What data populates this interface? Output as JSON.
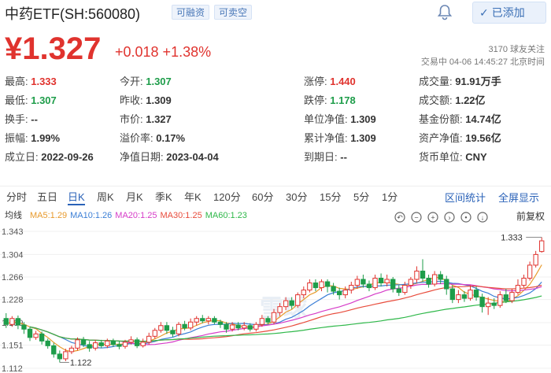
{
  "header": {
    "title": "中药ETF(SH:560080)",
    "tags": [
      "可融资",
      "可卖空"
    ],
    "add_label": "已添加"
  },
  "quote": {
    "price": "¥1.327",
    "change": "+0.018  +1.38%",
    "followers": "3170 球友关注",
    "trade_time": "交易中 04-06 14:45:27 北京时间"
  },
  "stats": [
    {
      "label": "最高:",
      "value": "1.333",
      "cls": "up"
    },
    {
      "label": "今开:",
      "value": "1.307",
      "cls": "down"
    },
    {
      "label": "涨停:",
      "value": "1.440",
      "cls": "up"
    },
    {
      "label": "成交量:",
      "value": "91.91万手",
      "cls": ""
    },
    {
      "label": "最低:",
      "value": "1.307",
      "cls": "down"
    },
    {
      "label": "昨收:",
      "value": "1.309",
      "cls": ""
    },
    {
      "label": "跌停:",
      "value": "1.178",
      "cls": "down"
    },
    {
      "label": "成交额:",
      "value": "1.22亿",
      "cls": ""
    },
    {
      "label": "换手:",
      "value": "--",
      "cls": ""
    },
    {
      "label": "市价:",
      "value": "1.327",
      "cls": ""
    },
    {
      "label": "单位净值:",
      "value": "1.309",
      "cls": ""
    },
    {
      "label": "基金份额:",
      "value": "14.74亿",
      "cls": ""
    },
    {
      "label": "振幅:",
      "value": "1.99%",
      "cls": ""
    },
    {
      "label": "溢价率:",
      "value": "0.17%",
      "cls": ""
    },
    {
      "label": "累计净值:",
      "value": "1.309",
      "cls": ""
    },
    {
      "label": "资产净值:",
      "value": "19.56亿",
      "cls": ""
    },
    {
      "label": "成立日:",
      "value": "2022-09-26",
      "cls": ""
    },
    {
      "label": "净值日期:",
      "value": "2023-04-04",
      "cls": ""
    },
    {
      "label": "到期日:",
      "value": "--",
      "cls": ""
    },
    {
      "label": "货币单位:",
      "value": "CNY",
      "cls": ""
    }
  ],
  "tabs": [
    "分时",
    "五日",
    "日K",
    "周K",
    "月K",
    "季K",
    "年K",
    "120分",
    "60分",
    "30分",
    "15分",
    "5分",
    "1分"
  ],
  "active_tab": "日K",
  "right_links": [
    "区间统计",
    "全屏显示"
  ],
  "chart": {
    "ma_label": "均线",
    "ma": [
      {
        "name": "MA5:1.29",
        "color": "#e89a2c"
      },
      {
        "name": "MA10:1.26",
        "color": "#3c7fd6"
      },
      {
        "name": "MA20:1.25",
        "color": "#d63cc8"
      },
      {
        "name": "MA30:1.25",
        "color": "#e84c3c"
      },
      {
        "name": "MA60:1.23",
        "color": "#2fb84a"
      }
    ],
    "adjust": "前复权",
    "y_ticks": [
      "1.343",
      "1.304",
      "1.266",
      "1.228",
      "1.189",
      "1.151",
      "1.112"
    ],
    "hi_label": "1.333",
    "lo_label": "1.122",
    "watermark": "雪球"
  },
  "chart_data": {
    "type": "candlestick",
    "ylim": [
      1.112,
      1.343
    ],
    "candles": [
      [
        1.196,
        1.186,
        1.205,
        1.18
      ],
      [
        1.186,
        1.196,
        1.2,
        1.182
      ],
      [
        1.196,
        1.185,
        1.201,
        1.178
      ],
      [
        1.185,
        1.178,
        1.19,
        1.17
      ],
      [
        1.178,
        1.164,
        1.182,
        1.158
      ],
      [
        1.164,
        1.17,
        1.175,
        1.16
      ],
      [
        1.17,
        1.158,
        1.174,
        1.152
      ],
      [
        1.158,
        1.15,
        1.162,
        1.145
      ],
      [
        1.15,
        1.136,
        1.155,
        1.13
      ],
      [
        1.136,
        1.128,
        1.142,
        1.122
      ],
      [
        1.128,
        1.14,
        1.145,
        1.124
      ],
      [
        1.14,
        1.146,
        1.15,
        1.136
      ],
      [
        1.146,
        1.16,
        1.164,
        1.142
      ],
      [
        1.16,
        1.152,
        1.165,
        1.148
      ],
      [
        1.152,
        1.146,
        1.158,
        1.14
      ],
      [
        1.146,
        1.155,
        1.16,
        1.142
      ],
      [
        1.155,
        1.15,
        1.16,
        1.146
      ],
      [
        1.15,
        1.158,
        1.162,
        1.146
      ],
      [
        1.158,
        1.152,
        1.162,
        1.148
      ],
      [
        1.152,
        1.149,
        1.158,
        1.144
      ],
      [
        1.149,
        1.156,
        1.16,
        1.145
      ],
      [
        1.156,
        1.16,
        1.166,
        1.152
      ],
      [
        1.16,
        1.15,
        1.164,
        1.146
      ],
      [
        1.15,
        1.156,
        1.162,
        1.147
      ],
      [
        1.156,
        1.166,
        1.172,
        1.152
      ],
      [
        1.166,
        1.176,
        1.18,
        1.162
      ],
      [
        1.176,
        1.184,
        1.19,
        1.172
      ],
      [
        1.184,
        1.176,
        1.19,
        1.17
      ],
      [
        1.176,
        1.17,
        1.182,
        1.165
      ],
      [
        1.17,
        1.186,
        1.19,
        1.166
      ],
      [
        1.186,
        1.18,
        1.192,
        1.176
      ],
      [
        1.18,
        1.19,
        1.196,
        1.176
      ],
      [
        1.19,
        1.196,
        1.2,
        1.184
      ],
      [
        1.196,
        1.192,
        1.202,
        1.188
      ],
      [
        1.192,
        1.196,
        1.2,
        1.186
      ],
      [
        1.196,
        1.19,
        1.2,
        1.186
      ],
      [
        1.19,
        1.186,
        1.194,
        1.18
      ],
      [
        1.186,
        1.178,
        1.19,
        1.172
      ],
      [
        1.178,
        1.185,
        1.19,
        1.174
      ],
      [
        1.185,
        1.18,
        1.19,
        1.176
      ],
      [
        1.18,
        1.184,
        1.19,
        1.176
      ],
      [
        1.184,
        1.178,
        1.188,
        1.174
      ],
      [
        1.178,
        1.186,
        1.19,
        1.174
      ],
      [
        1.186,
        1.196,
        1.202,
        1.182
      ],
      [
        1.196,
        1.19,
        1.2,
        1.186
      ],
      [
        1.19,
        1.206,
        1.212,
        1.186
      ],
      [
        1.206,
        1.216,
        1.222,
        1.2
      ],
      [
        1.216,
        1.226,
        1.232,
        1.21
      ],
      [
        1.226,
        1.218,
        1.232,
        1.212
      ],
      [
        1.218,
        1.236,
        1.24,
        1.214
      ],
      [
        1.236,
        1.244,
        1.25,
        1.23
      ],
      [
        1.244,
        1.256,
        1.262,
        1.24
      ],
      [
        1.256,
        1.248,
        1.262,
        1.242
      ],
      [
        1.248,
        1.258,
        1.262,
        1.242
      ],
      [
        1.258,
        1.25,
        1.262,
        1.24
      ],
      [
        1.25,
        1.242,
        1.256,
        1.236
      ],
      [
        1.242,
        1.236,
        1.248,
        1.228
      ],
      [
        1.236,
        1.244,
        1.25,
        1.23
      ],
      [
        1.244,
        1.252,
        1.258,
        1.238
      ],
      [
        1.252,
        1.262,
        1.268,
        1.246
      ],
      [
        1.262,
        1.254,
        1.27,
        1.248
      ],
      [
        1.254,
        1.248,
        1.26,
        1.242
      ],
      [
        1.248,
        1.264,
        1.27,
        1.244
      ],
      [
        1.264,
        1.256,
        1.272,
        1.25
      ],
      [
        1.256,
        1.262,
        1.27,
        1.25
      ],
      [
        1.262,
        1.246,
        1.266,
        1.24
      ],
      [
        1.246,
        1.24,
        1.252,
        1.234
      ],
      [
        1.24,
        1.252,
        1.258,
        1.236
      ],
      [
        1.252,
        1.262,
        1.266,
        1.246
      ],
      [
        1.262,
        1.276,
        1.284,
        1.256
      ],
      [
        1.276,
        1.264,
        1.296,
        1.258
      ],
      [
        1.264,
        1.254,
        1.27,
        1.248
      ],
      [
        1.254,
        1.27,
        1.276,
        1.25
      ],
      [
        1.27,
        1.262,
        1.276,
        1.254
      ],
      [
        1.262,
        1.246,
        1.268,
        1.236
      ],
      [
        1.246,
        1.228,
        1.252,
        1.222
      ],
      [
        1.228,
        1.236,
        1.244,
        1.222
      ],
      [
        1.236,
        1.23,
        1.242,
        1.224
      ],
      [
        1.23,
        1.244,
        1.252,
        1.226
      ],
      [
        1.244,
        1.232,
        1.25,
        1.226
      ],
      [
        1.232,
        1.216,
        1.238,
        1.206
      ],
      [
        1.216,
        1.222,
        1.232,
        1.202
      ],
      [
        1.222,
        1.218,
        1.23,
        1.212
      ],
      [
        1.218,
        1.236,
        1.242,
        1.214
      ],
      [
        1.236,
        1.226,
        1.246,
        1.222
      ],
      [
        1.226,
        1.24,
        1.246,
        1.222
      ],
      [
        1.24,
        1.252,
        1.262,
        1.236
      ],
      [
        1.252,
        1.264,
        1.27,
        1.248
      ],
      [
        1.264,
        1.286,
        1.292,
        1.26
      ],
      [
        1.286,
        1.304,
        1.31,
        1.282
      ],
      [
        1.309,
        1.327,
        1.333,
        1.307
      ]
    ]
  }
}
